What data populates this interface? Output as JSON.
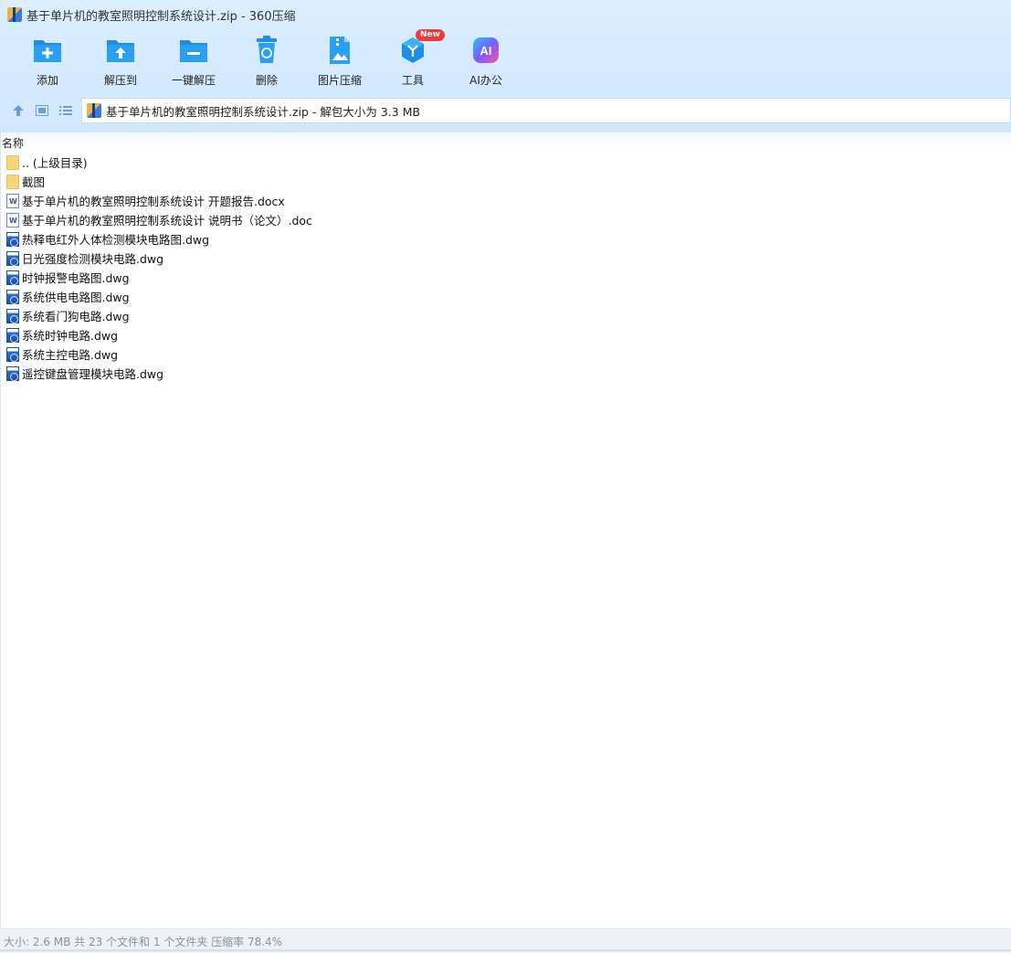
{
  "window": {
    "title": "基于单片机的教室照明控制系统设计.zip - 360压缩"
  },
  "toolbar": {
    "items": [
      {
        "label": "添加",
        "icon": "add-folder-icon"
      },
      {
        "label": "解压到",
        "icon": "extract-to-icon"
      },
      {
        "label": "一键解压",
        "icon": "quick-extract-icon"
      },
      {
        "label": "删除",
        "icon": "delete-icon"
      },
      {
        "label": "图片压缩",
        "icon": "image-compress-icon"
      },
      {
        "label": "工具",
        "icon": "tools-icon",
        "badge": "New"
      },
      {
        "label": "AI办公",
        "icon": "ai-office-icon",
        "icon_text": "AI"
      }
    ]
  },
  "navbar": {
    "path": "基于单片机的教室照明控制系统设计.zip - 解包大小为 3.3 MB"
  },
  "list": {
    "column_header": "名称",
    "rows": [
      {
        "name": ".. (上级目录)",
        "type": "folder"
      },
      {
        "name": "截图",
        "type": "folder"
      },
      {
        "name": "基于单片机的教室照明控制系统设计 开题报告.docx",
        "type": "doc"
      },
      {
        "name": "基于单片机的教室照明控制系统设计 说明书（论文）.doc",
        "type": "doc"
      },
      {
        "name": "热释电红外人体检测模块电路图.dwg",
        "type": "dwg"
      },
      {
        "name": "日光强度检测模块电路.dwg",
        "type": "dwg"
      },
      {
        "name": "时钟报警电路图.dwg",
        "type": "dwg"
      },
      {
        "name": "系统供电电路图.dwg",
        "type": "dwg"
      },
      {
        "name": "系统看门狗电路.dwg",
        "type": "dwg"
      },
      {
        "name": "系统时钟电路.dwg",
        "type": "dwg"
      },
      {
        "name": "系统主控电路.dwg",
        "type": "dwg"
      },
      {
        "name": "遥控键盘管理模块电路.dwg",
        "type": "dwg"
      }
    ]
  },
  "status": {
    "text": "大小: 2.6 MB 共 23 个文件和 1 个文件夹 压缩率 78.4%"
  },
  "colors": {
    "chrome_bg": "#d6eaff",
    "accent_blue": "#1e8ee8",
    "badge_red": "#f03a3a"
  }
}
